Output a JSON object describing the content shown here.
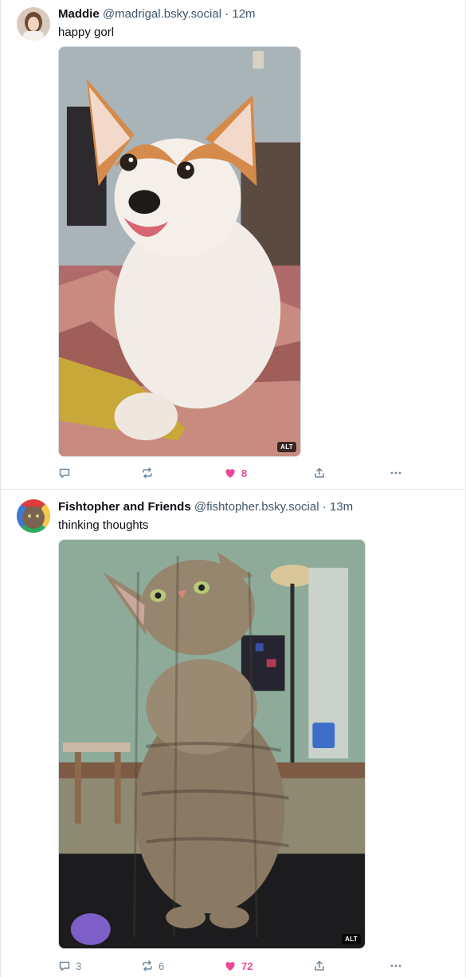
{
  "posts": [
    {
      "author_name": "Maddie",
      "author_handle": "@madrigal.bsky.social",
      "separator": "·",
      "time": "12m",
      "text": "happy gorl",
      "image_alt_badge": "ALT",
      "image_subject": "corgi dog sitting on a bed",
      "counts": {
        "reply": "",
        "repost": "",
        "like": "8"
      },
      "liked": true
    },
    {
      "author_name": "Fishtopher and Friends",
      "author_handle": "@fishtopher.bsky.social",
      "separator": "·",
      "time": "13m",
      "text": "thinking thoughts",
      "image_alt_badge": "ALT",
      "image_subject": "tabby cat looking upward",
      "counts": {
        "reply": "3",
        "repost": "6",
        "like": "72"
      },
      "liked": true
    }
  ],
  "icons": {
    "reply": "reply-icon",
    "repost": "repost-icon",
    "like": "heart-icon",
    "share": "share-icon",
    "more": "more-icon"
  },
  "colors": {
    "like_active": "#ec4899",
    "action_gray": "#6f869f",
    "handle_gray": "#42576c",
    "divider": "#e3e7eb"
  }
}
